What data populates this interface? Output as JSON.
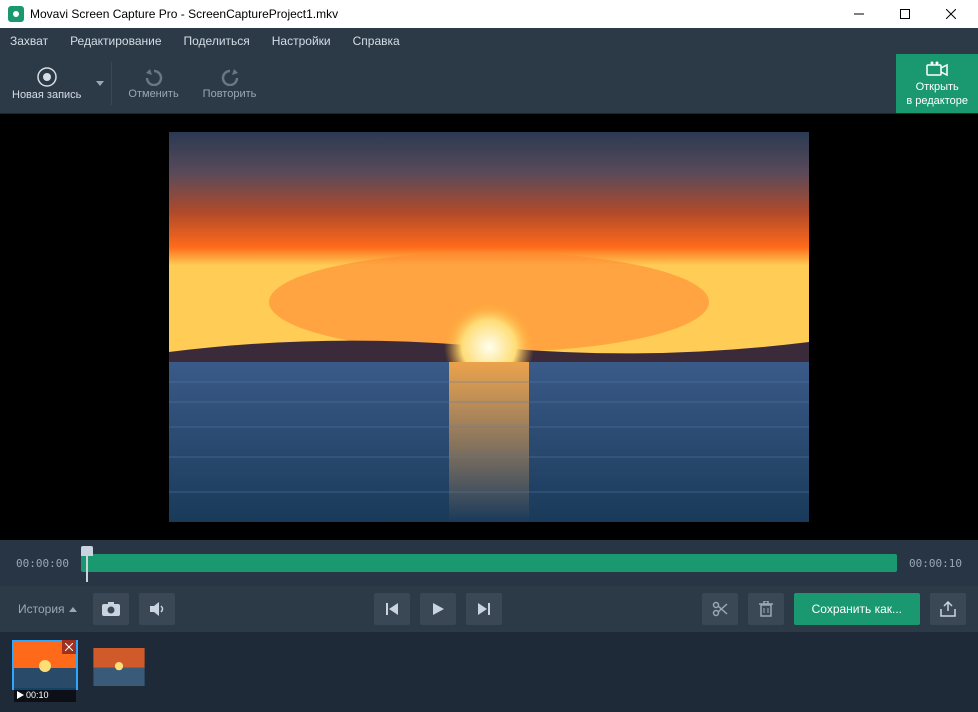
{
  "window": {
    "title": "Movavi Screen Capture Pro - ScreenCaptureProject1.mkv"
  },
  "menu": {
    "items": [
      "Захват",
      "Редактирование",
      "Поделиться",
      "Настройки",
      "Справка"
    ]
  },
  "toolbar": {
    "new_rec": "Новая запись",
    "undo": "Отменить",
    "redo": "Повторить",
    "open_editor_line1": "Открыть",
    "open_editor_line2": "в редакторе"
  },
  "timeline": {
    "start": "00:00:00",
    "end": "00:00:10"
  },
  "controls": {
    "history": "История",
    "save_as": "Сохранить как..."
  },
  "thumbs": {
    "duration": "00:10"
  },
  "colors": {
    "accent": "#1a9970"
  }
}
